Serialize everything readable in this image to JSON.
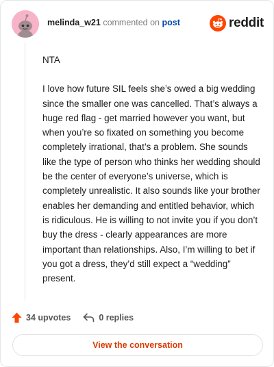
{
  "comment": {
    "author": "melinda_w21",
    "action_text": "commented on",
    "target_link": "post",
    "paragraphs": [
      "NTA",
      "I love how future SIL feels she’s owed a big wedding since the smaller one was cancelled. That’s always a huge red flag - get married however you want, but when you’re so fixated on something you become completely irrational, that’s a problem. She sounds like the type of person who thinks her wedding should be the center of everyone’s universe, which is completely unrealistic. It also sounds like your brother enables her demanding and entitled behavior, which is ridiculous. He is willing to not invite you if you don’t buy the dress - clearly appearances are more important than relationships. Also, I’m willing to bet if you got a dress, they’d still expect a “wedding” present."
    ]
  },
  "brand": {
    "name": "reddit",
    "icon": "reddit-snoo-icon",
    "color": "#ff4500"
  },
  "stats": {
    "upvotes": "34 upvotes",
    "upvote_icon": "upvote-arrow-icon",
    "upvote_color": "#ff4500",
    "replies": "0 replies",
    "reply_icon": "reply-arrow-icon"
  },
  "cta": {
    "label": "View the conversation",
    "color": "#d93a00"
  },
  "avatar": {
    "icon": "snoo-avatar-icon",
    "background": "#f7b4c8"
  }
}
